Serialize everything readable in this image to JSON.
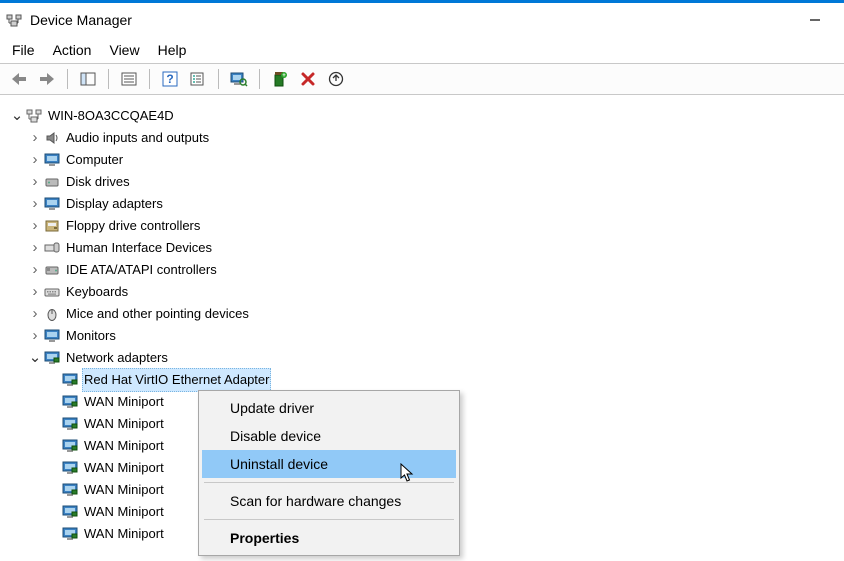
{
  "window": {
    "title": "Device Manager"
  },
  "menu": {
    "file": "File",
    "action": "Action",
    "view": "View",
    "help": "Help"
  },
  "tree": {
    "root": "WIN-8OA3CCQAE4D",
    "audio": "Audio inputs and outputs",
    "computer": "Computer",
    "disk": "Disk drives",
    "display": "Display adapters",
    "floppy": "Floppy drive controllers",
    "hid": "Human Interface Devices",
    "ide": "IDE ATA/ATAPI controllers",
    "keyboards": "Keyboards",
    "mice": "Mice and other pointing devices",
    "monitors": "Monitors",
    "net": "Network adapters",
    "redhat": "Red Hat VirtIO Ethernet Adapter",
    "wan1": "WAN Miniport",
    "wan2": "WAN Miniport",
    "wan3": "WAN Miniport",
    "wan4": "WAN Miniport",
    "wan5": "WAN Miniport",
    "wan6": "WAN Miniport",
    "wan7": "WAN Miniport"
  },
  "context_menu": {
    "update": "Update driver",
    "disable": "Disable device",
    "uninstall": "Uninstall device",
    "scan": "Scan for hardware changes",
    "properties": "Properties"
  }
}
